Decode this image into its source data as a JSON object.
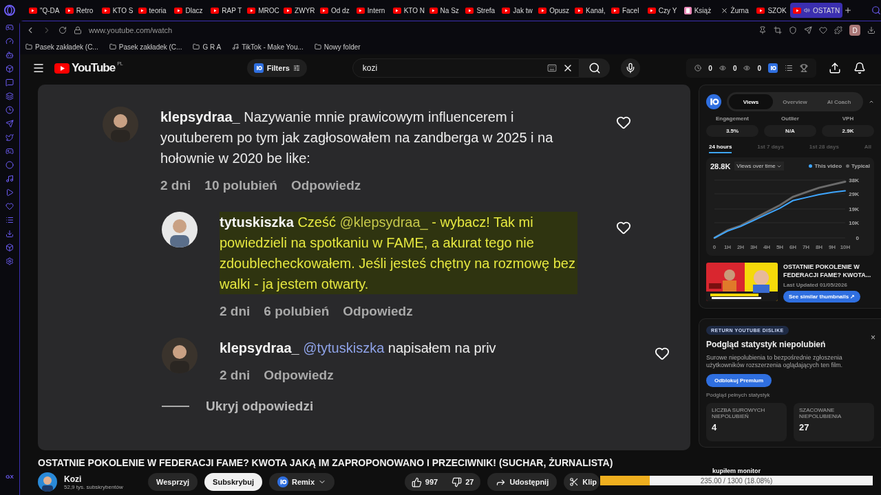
{
  "browser": {
    "tabs": [
      {
        "label": "\"Q-DA",
        "kind": "youtube",
        "selected": false
      },
      {
        "label": "Retro",
        "kind": "youtube",
        "selected": false
      },
      {
        "label": "KTO S",
        "kind": "youtube",
        "selected": false
      },
      {
        "label": "teoria",
        "kind": "youtube",
        "selected": false
      },
      {
        "label": "Dlacz",
        "kind": "youtube",
        "selected": false
      },
      {
        "label": "RAP T",
        "kind": "youtube",
        "selected": false
      },
      {
        "label": "MROC",
        "kind": "youtube",
        "selected": false
      },
      {
        "label": "ZWYR",
        "kind": "youtube",
        "selected": false
      },
      {
        "label": "Od dz",
        "kind": "youtube",
        "selected": false
      },
      {
        "label": "Intern",
        "kind": "youtube",
        "selected": false
      },
      {
        "label": "KTO N",
        "kind": "youtube",
        "selected": false
      },
      {
        "label": "Na Sz",
        "kind": "youtube",
        "selected": false
      },
      {
        "label": "Strefa",
        "kind": "youtube",
        "selected": false
      },
      {
        "label": "Jak tw",
        "kind": "youtube",
        "selected": false
      },
      {
        "label": "Opusz",
        "kind": "youtube",
        "selected": false
      },
      {
        "label": "Kanał,",
        "kind": "youtube",
        "selected": false
      },
      {
        "label": "Facel",
        "kind": "youtube",
        "selected": false
      },
      {
        "label": "Czy Y",
        "kind": "youtube",
        "selected": false
      },
      {
        "label": "Książ",
        "kind": "pinterest",
        "selected": false
      },
      {
        "label": "Żurna",
        "kind": "x",
        "selected": false
      },
      {
        "label": "SZOK",
        "kind": "youtube",
        "selected": false
      },
      {
        "label": "OSTATN",
        "kind": "youtube",
        "selected": true
      }
    ],
    "url": "www.youtube.com/watch",
    "profile_initial": "D",
    "bookmarks": [
      {
        "label": "Pasek zakładek (C...",
        "kind": "folder"
      },
      {
        "label": "Pasek zakładek (C...",
        "kind": "folder"
      },
      {
        "label": "G R A",
        "kind": "folder"
      },
      {
        "label": "TikTok - Make You...",
        "kind": "tiktok"
      },
      {
        "label": "Nowy folder",
        "kind": "folder"
      }
    ],
    "sidebar_footer": "GX"
  },
  "header": {
    "logo": "YouTube",
    "region": "PL",
    "filters": "Filters",
    "search": {
      "value": "kozi"
    },
    "counters": [
      "0",
      "0",
      "0"
    ]
  },
  "comments": [
    {
      "user": "klepsydraa_",
      "highlighted": false,
      "segments": [
        {
          "kind": "plain",
          "text": "Nazywanie mnie prawicowym influencerem i youtuberem po tym jak zagłosowałem na zandberga w 2025 i na hołownie w 2020 be like:"
        }
      ],
      "meta": [
        "2 dni",
        "10 polubień",
        "Odpowiedz"
      ],
      "replies": [
        {
          "user": "tytuskiszka",
          "highlighted": true,
          "segments": [
            {
              "kind": "plain",
              "text": "Cześć "
            },
            {
              "kind": "mention",
              "text": "@klepsydraa_"
            },
            {
              "kind": "plain",
              "text": " - wybacz! Tak mi powiedzieli na spotkaniu w FAME, a akurat tego nie zdoublecheckowałem. Jeśli jesteś chętny na rozmowę bez walki - ja jestem otwarty."
            }
          ],
          "meta": [
            "2 dni",
            "6 polubień",
            "Odpowiedz"
          ]
        },
        {
          "user": "klepsydraa_",
          "highlighted": false,
          "segments": [
            {
              "kind": "mention",
              "text": "@tytuskiszka"
            },
            {
              "kind": "plain",
              "text": " napisałem na priv"
            }
          ],
          "meta": [
            "2 dni",
            "Odpowiedz"
          ]
        }
      ],
      "hide_replies": "Ukryj odpowiedzi"
    }
  ],
  "video": {
    "title": "OSTATNIE POKOLENIE W FEDERACJI FAME? KWOTA JAKĄ IM ZAPROPONOWANO I PRZECIWNIK! (SUCHAR, ŻURNALISTA)",
    "channel": "Kozi",
    "subscribers": "52,9 tys. subskrybentów",
    "support": "Wesprzyj",
    "subscribe": "Subskrybuj",
    "remix": "Remix",
    "likes": "997",
    "dislikes": "27",
    "share": "Udostępnij",
    "clip": "Klip"
  },
  "vidiq": {
    "tabs": [
      {
        "label": "Views",
        "selected": true
      },
      {
        "label": "Overview",
        "selected": false
      },
      {
        "label": "AI Coach",
        "selected": false
      }
    ],
    "metrics": [
      {
        "label": "Engagement",
        "value": "3.5%"
      },
      {
        "label": "Outlier",
        "value": "N/A"
      },
      {
        "label": "VPH",
        "value": "2.9K"
      }
    ],
    "ranges": [
      {
        "label": "24 hours",
        "selected": true
      },
      {
        "label": "1st 7 days",
        "selected": false
      },
      {
        "label": "1st 28 days",
        "selected": false
      },
      {
        "label": "All",
        "selected": false
      }
    ],
    "total": "28.8K",
    "chart_select": "Views over time",
    "chart_data": {
      "type": "line",
      "grid": true,
      "categories": [
        "0",
        "1H",
        "2H",
        "3H",
        "4H",
        "5H",
        "6H",
        "7H",
        "8H",
        "9H",
        "10H"
      ],
      "ylim": [
        0,
        38000
      ],
      "yticks": [
        {
          "value": 0,
          "label": "0"
        },
        {
          "value": 10000,
          "label": "10K"
        },
        {
          "value": 19000,
          "label": "19K"
        },
        {
          "value": 29000,
          "label": "29K"
        },
        {
          "value": 38000,
          "label": "38K"
        }
      ],
      "series": [
        {
          "name": "This video",
          "color": "#3ea6ff",
          "values": [
            0,
            4500,
            7500,
            11500,
            15500,
            19500,
            24500,
            26500,
            28500,
            30000,
            31000
          ]
        },
        {
          "name": "Typical",
          "color": "#6b6b6b",
          "values": [
            0,
            5000,
            8000,
            12500,
            17000,
            21500,
            27000,
            30000,
            33000,
            35000,
            37000
          ]
        }
      ]
    },
    "suggestion": {
      "title": "OSTATNIE POKOLENIE W FEDERACJI FAME? KWOTA...",
      "updated": "Last Updated 01/05/2026",
      "button": "See similar thumbnails ↗"
    }
  },
  "dislike_card": {
    "badge": "RETURN YOUTUBE DISLIKE",
    "close": "×",
    "title": "Podgląd statystyk niepolubień",
    "description": "Surowe niepolubienia to bezpośrednie zgłoszenia użytkowników rozszerzenia oglądających ten film.",
    "button": "Odblokuj Premium",
    "note": "Podgląd pełnych statystyk",
    "stats": [
      {
        "label": "LICZBA SUROWYCH NIEPOLUBIEŃ",
        "value": "4"
      },
      {
        "label": "SZACOWANE NIEPOLUBIENIA",
        "value": "27"
      }
    ]
  },
  "goal": {
    "label": "kupiłem monitor",
    "level": 0.1808,
    "reading": "235.00 / 1300 (18.08%)"
  }
}
